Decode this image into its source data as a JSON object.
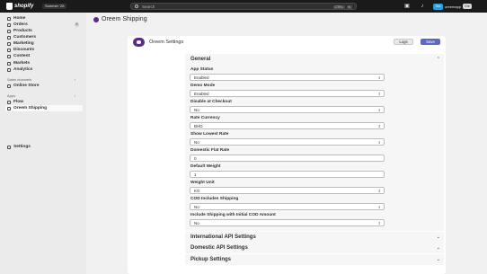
{
  "topbar": {
    "brand": "shopify",
    "edition": "Summer '25",
    "search_placeholder": "Search",
    "shortcut_key1": "CTRL",
    "shortcut_key2": "K",
    "store_avatar": "Ore",
    "store_name": "oreemapp",
    "store_name2": "Ore"
  },
  "sidebar": {
    "items": [
      {
        "label": "Home"
      },
      {
        "label": "Orders",
        "badge": "5"
      },
      {
        "label": "Products"
      },
      {
        "label": "Customers"
      },
      {
        "label": "Marketing"
      },
      {
        "label": "Discounts"
      },
      {
        "label": "Content"
      },
      {
        "label": "Markets"
      },
      {
        "label": "Analytics"
      }
    ],
    "sales_channels_label": "Sales channels",
    "online_store": "Online Store",
    "apps_label": "Apps",
    "flow": "Flow",
    "oreem_shipping": "Oreem Shipping",
    "settings": "Settings"
  },
  "main": {
    "app_title": "Oreem Shipping",
    "card_title": "Oreem Settings",
    "logs_label": "Logs",
    "save_label": "Save"
  },
  "sections": {
    "general": "General",
    "international": "International API Settings",
    "domestic": "Domestic API Settings",
    "pickup": "Pickup Settings"
  },
  "fields": [
    {
      "label": "App Status",
      "value": "Enabled"
    },
    {
      "label": "Demo Mode",
      "value": "Enabled"
    },
    {
      "label": "Disable at Checkout",
      "value": "No"
    },
    {
      "label": "Rate Currency",
      "value": "BHD"
    },
    {
      "label": "Show Lowest Rate",
      "value": "No"
    },
    {
      "label": "Domestic Flat Rate",
      "value": "0"
    },
    {
      "label": "Default Weight",
      "value": "1"
    },
    {
      "label": "Weight Unit",
      "value": "KG"
    },
    {
      "label": "COD Includes Shipping",
      "value": "No"
    },
    {
      "label": "Include Shipping with Initial COD Amount",
      "value": "No"
    }
  ]
}
